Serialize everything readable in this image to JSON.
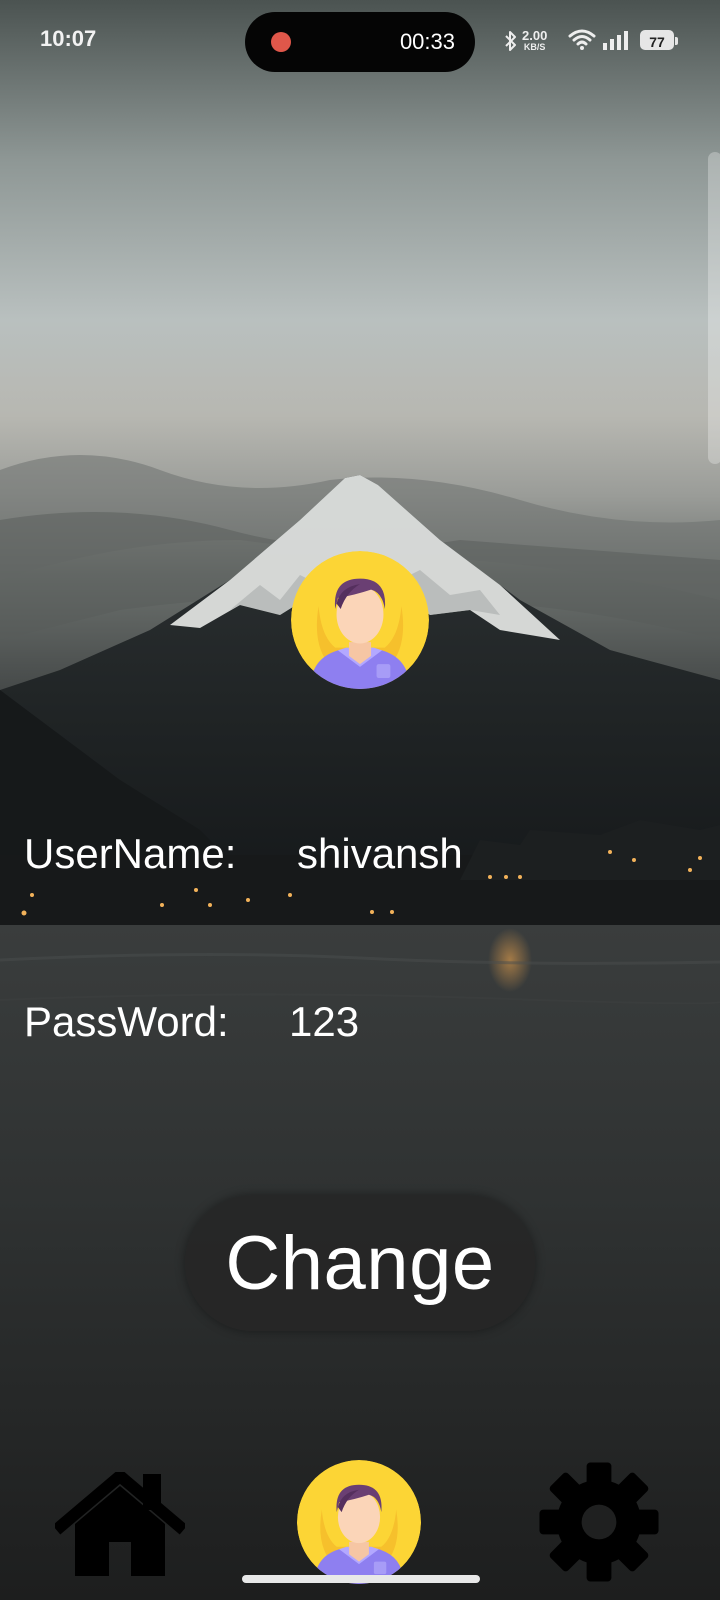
{
  "status_bar": {
    "time": "10:07",
    "recording_time": "00:33",
    "net_speed_value": "2.00",
    "net_speed_unit": "KB/S",
    "battery_level": "77"
  },
  "profile": {
    "avatar_icon": "user-avatar-icon",
    "username_label": "UserName:",
    "username_value": "shivansh",
    "password_label": "PassWord:",
    "password_value": "123"
  },
  "actions": {
    "change_label": "Change"
  },
  "bottom_nav": {
    "items": [
      {
        "icon": "home-icon"
      },
      {
        "icon": "user-avatar-icon"
      },
      {
        "icon": "gear-icon"
      }
    ]
  },
  "colors": {
    "accent_yellow": "#FCD535",
    "shirt_purple": "#8E7FF0",
    "recording_red": "#E0574A"
  }
}
